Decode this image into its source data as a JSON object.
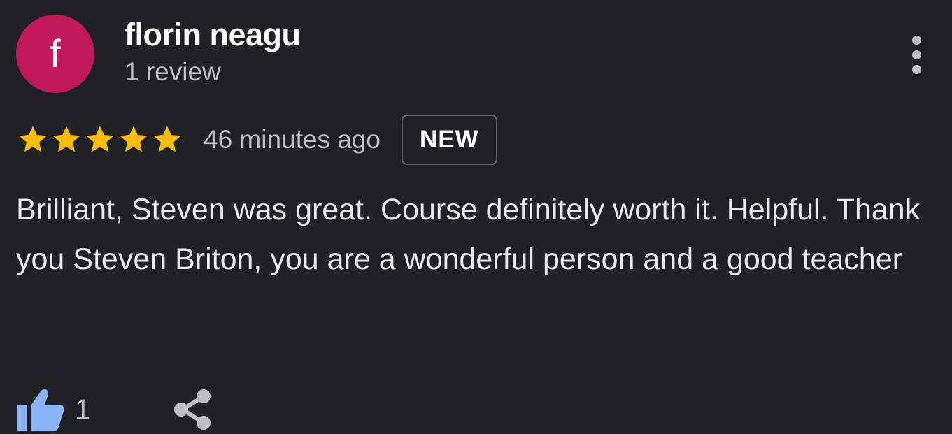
{
  "review": {
    "avatar_letter": "f",
    "avatar_color": "#c2185b",
    "author_name": "florin neagu",
    "review_count": "1 review",
    "rating": 5,
    "rating_max": 5,
    "star_color": "#fbbc04",
    "time_ago": "46 minutes ago",
    "badge": "NEW",
    "text": "Brilliant, Steven was great. Course definitely worth it. Helpful. Thank you Steven Briton, you are a wonderful person and a good teacher",
    "like_count": "1",
    "like_color": "#8ab4f8"
  },
  "icons": {
    "more": "more-vert-icon",
    "star": "star-icon",
    "like": "thumb-up-icon",
    "share": "share-icon"
  }
}
